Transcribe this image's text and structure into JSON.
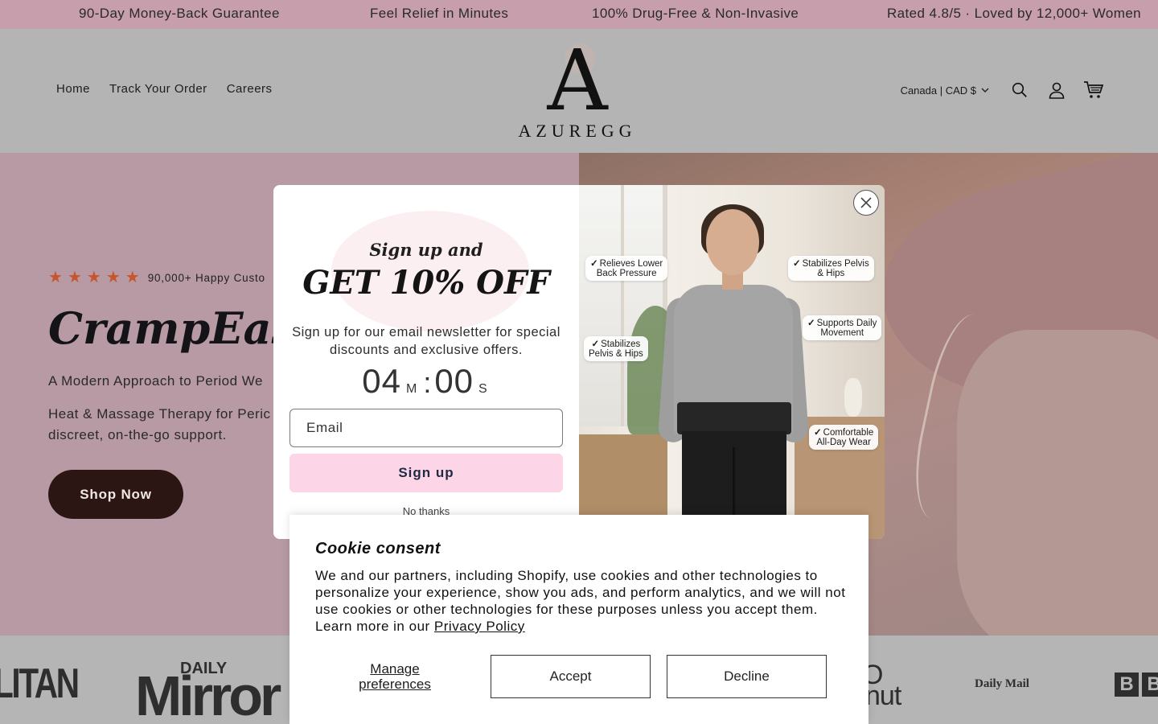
{
  "announcement": {
    "items": [
      "90-Day Money-Back Guarantee",
      "Feel Relief in Minutes",
      "100% Drug-Free & Non-Invasive",
      "Rated 4.8/5 · Loved by 12,000+ Women"
    ]
  },
  "header": {
    "nav": [
      "Home",
      "Track Your Order",
      "Careers"
    ],
    "logo_mark": "A",
    "logo_text": "AZUREGG",
    "country": "Canada | CAD $",
    "icons": [
      "search-icon",
      "account-icon",
      "cart-icon"
    ]
  },
  "hero": {
    "rating_stars": 5,
    "social_proof": "90,000+ Happy Custo",
    "title": "CrampEase",
    "subtitle": "A Modern Approach to Period We",
    "description": "Heat & Massage Therapy for Peric discreet, on-the-go support.",
    "cta": "Shop Now"
  },
  "press": {
    "logos": [
      "LITAN",
      "DAILY",
      "Mirror",
      "O",
      "nut",
      "Daily Mail",
      "B",
      "B"
    ]
  },
  "popup": {
    "kicker": "Sign up and",
    "headline": "GET 10% OFF",
    "body": "Sign up for our email newsletter for special discounts and exclusive offers.",
    "timer": {
      "minutes": "04",
      "minutes_unit": "M",
      "separator": ":",
      "seconds": "00",
      "seconds_unit": "S"
    },
    "email_placeholder": "Email",
    "signup_label": "Sign up",
    "no_thanks": "No thanks",
    "image_tags": [
      {
        "line1": "Relieves Lower",
        "line2": "Back Pressure"
      },
      {
        "line1": "Stabilizes Pelvis",
        "line2": "& Hips"
      },
      {
        "line1": "Supports Daily",
        "line2": "Movement"
      },
      {
        "line1": "Stabilizes",
        "line2": "Pelvis & Hips"
      },
      {
        "line1": "Comfortable",
        "line2": "All-Day Wear"
      }
    ]
  },
  "cookie": {
    "title": "Cookie consent",
    "body": "We and our partners, including Shopify, use cookies and other technologies to personalize your experience, show you ads, and perform analytics, and we will not use cookies or other technologies for these purposes unless you accept them. Learn more in our",
    "policy_link": "Privacy Policy",
    "manage": "Manage preferences",
    "accept": "Accept",
    "decline": "Decline"
  },
  "colors": {
    "announcement_bg": "#c79eac",
    "hero_left_bg": "#b79aa3",
    "cta_bg": "#2b1613",
    "star": "#c7552e",
    "signup_bg": "#fcd6e6"
  }
}
